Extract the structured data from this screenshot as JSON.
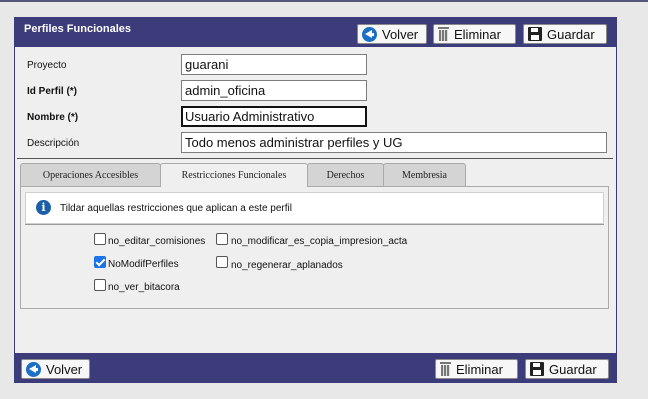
{
  "panel": {
    "title": "Perfiles Funcionales",
    "buttons": {
      "back": "Volver",
      "delete": "Eliminar",
      "save": "Guardar"
    }
  },
  "form": {
    "proyecto": {
      "label": "Proyecto",
      "value": "guarani"
    },
    "id_perfil": {
      "label": "Id Perfil (*)",
      "value": "admin_oficina"
    },
    "nombre": {
      "label": "Nombre (*)",
      "value": "Usuario Administrativo"
    },
    "descripcion": {
      "label": "Descripción",
      "value": "Todo menos administrar perfiles y UG"
    }
  },
  "tabs": [
    {
      "label": "Operaciones Accesibles",
      "active": false
    },
    {
      "label": "Restricciones Funcionales",
      "active": true
    },
    {
      "label": "Derechos",
      "active": false
    },
    {
      "label": "Membresia",
      "active": false
    }
  ],
  "restricciones": {
    "info": "Tildar aquellas restricciones que aplican a este perfil",
    "items": [
      {
        "label": "no_editar_comisiones",
        "checked": false
      },
      {
        "label": "no_modificar_es_copia_impresion_acta",
        "checked": false
      },
      {
        "label": "NoModifPerfiles",
        "checked": true
      },
      {
        "label": "no_regenerar_aplanados",
        "checked": false
      },
      {
        "label": "no_ver_bitacora",
        "checked": false
      }
    ]
  },
  "colors": {
    "header": "#3c3c7a",
    "checkbox_checked": "#1a73e8"
  }
}
